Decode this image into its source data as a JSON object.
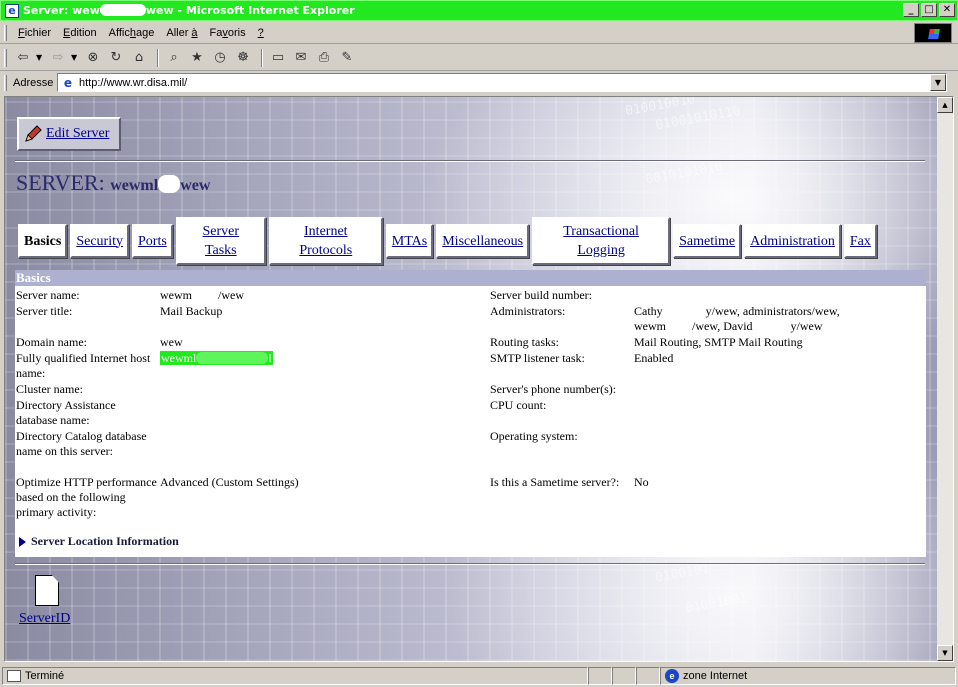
{
  "window": {
    "title_prefix": "Server: wew",
    "title_suffix": "wew - Microsoft Internet Explorer",
    "minimize": "_",
    "maximize": "□",
    "close": "✕"
  },
  "menu": [
    {
      "hot": "F",
      "rest": "ichier"
    },
    {
      "hot": "E",
      "rest": "dition"
    },
    {
      "hot": "",
      "pre": "Affic",
      "hot2": "h",
      "rest": "age"
    },
    {
      "hot": "",
      "pre": "Aller ",
      "hot2": "à",
      "rest": ""
    },
    {
      "hot": "",
      "pre": "Fa",
      "hot2": "v",
      "rest": "oris"
    },
    {
      "hot": "?",
      "rest": ""
    }
  ],
  "toolbar": {
    "back": "⇦",
    "forward": "⇨",
    "stop": "⊗",
    "refresh": "↻",
    "home": "⌂",
    "search": "⌕",
    "favorites": "★",
    "history": "◷",
    "channels": "☸",
    "fullscreen": "▭",
    "mail": "✉",
    "print": "⎙",
    "edit": "✎"
  },
  "address": {
    "label": "Adresse",
    "url": "http://www.wr.disa.mil/",
    "dropdown": "▼"
  },
  "page": {
    "edit_server": "Edit Server",
    "server_prefix": "SERVER:",
    "server_name_a": "wewml",
    "server_name_b": "wew",
    "binary_rows": [
      "010010010",
      "01001010110",
      "0010101010",
      "0100101",
      "01001001"
    ],
    "tabs": [
      {
        "line1": "Basics",
        "line2": "",
        "active": true
      },
      {
        "line1": "Security",
        "line2": ""
      },
      {
        "line1": "Ports",
        "line2": ""
      },
      {
        "line1": "Server",
        "line2": "Tasks"
      },
      {
        "line1": "Internet",
        "line2": "Protocols"
      },
      {
        "line1": "MTAs",
        "line2": ""
      },
      {
        "line1": "Miscellaneous",
        "line2": ""
      },
      {
        "line1": "Transactional",
        "line2": "Logging"
      },
      {
        "line1": "Sametime",
        "line2": ""
      },
      {
        "line1": "Administration",
        "line2": ""
      },
      {
        "line1": "Fax",
        "line2": ""
      }
    ],
    "basics_header": "Basics",
    "left": [
      {
        "label": "Server name:",
        "value": "wewm",
        "value_b": "/wew"
      },
      {
        "label": "Server title:",
        "value": "Mail Backup"
      },
      {
        "label": "Domain name:",
        "value": "wew"
      },
      {
        "label": "Fully qualified Internet host name:",
        "value": "wewml",
        "value_b": "l"
      },
      {
        "label": "Cluster name:",
        "value": ""
      },
      {
        "label": "Directory Assistance database name:",
        "value": ""
      },
      {
        "label": "Directory Catalog database name on this server:",
        "value": ""
      },
      {
        "label": "Optimize HTTP performance based on the following primary activity:",
        "value": "Advanced (Custom Settings)"
      }
    ],
    "right": [
      {
        "label": "Server build number:",
        "value": ""
      },
      {
        "label": "Administrators:",
        "v1a": "Cathy ",
        "v1b": "y/wew, administrators/wew,",
        "v2a": "wewm",
        "v2b": "/wew, David",
        "v2c": "y/wew"
      },
      {
        "label": "Routing tasks:",
        "value": "Mail Routing, SMTP Mail Routing"
      },
      {
        "label": "SMTP listener task:",
        "value": "Enabled"
      },
      {
        "label": "Server's phone number(s):",
        "value": ""
      },
      {
        "label": "CPU count:",
        "value": ""
      },
      {
        "label": "Operating system:",
        "value": ""
      },
      {
        "label": "Is this a Sametime server?:",
        "value": "No"
      }
    ],
    "location_info": "Server Location Information",
    "server_id": "ServerID"
  },
  "status": {
    "text": "Terminé",
    "zone": "zone Internet"
  },
  "colors": {
    "title_bar": "#21e81f",
    "link": "#00008b",
    "basics_header": "#aeb0d0"
  }
}
